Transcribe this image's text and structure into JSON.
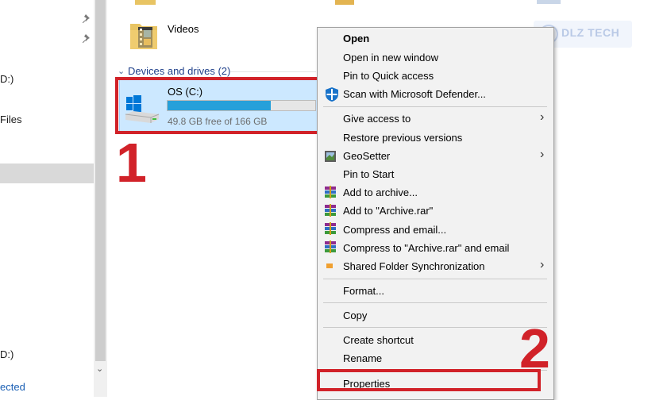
{
  "nav": {
    "items": [
      {
        "label": "D:)"
      },
      {
        "label": "Files"
      },
      {
        "label": "D:)"
      },
      {
        "label": "ected"
      }
    ]
  },
  "main": {
    "videos_label": "Videos",
    "section_label": "Devices and drives (2)",
    "drive": {
      "name": "OS (C:)",
      "free_text": "49.8 GB free of 166 GB",
      "used_fraction": 0.7
    }
  },
  "annotations": {
    "step1": "1",
    "step2": "2"
  },
  "watermark": "DLZ TECH",
  "menu": {
    "open": "Open",
    "open_new_window": "Open in new window",
    "pin_quick_access": "Pin to Quick access",
    "scan_defender": "Scan with Microsoft Defender...",
    "give_access": "Give access to",
    "restore_versions": "Restore previous versions",
    "geosetter": "GeoSetter",
    "pin_start": "Pin to Start",
    "add_archive": "Add to archive...",
    "add_archive_rar": "Add to \"Archive.rar\"",
    "compress_email": "Compress and email...",
    "compress_rar_email": "Compress to \"Archive.rar\" and email",
    "shared_sync": "Shared Folder Synchronization",
    "format": "Format...",
    "copy": "Copy",
    "create_shortcut": "Create shortcut",
    "rename": "Rename",
    "properties": "Properties"
  },
  "colors": {
    "accent": "#26a0da",
    "highlight_red": "#d12229",
    "selection": "#cce8ff"
  }
}
